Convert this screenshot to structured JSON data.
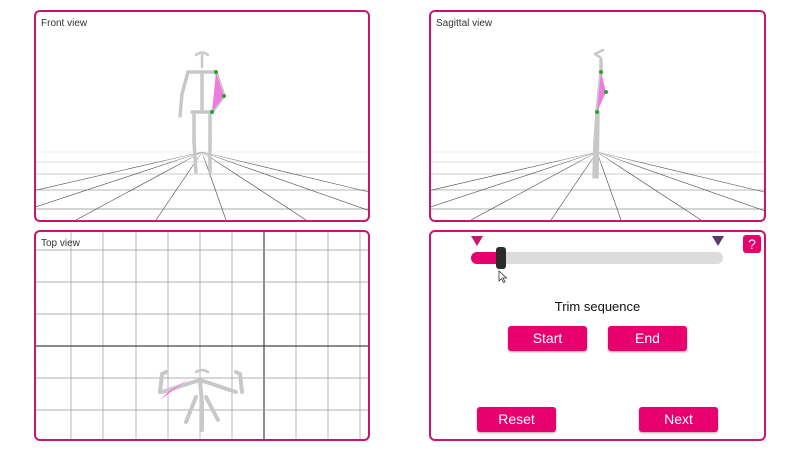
{
  "views": {
    "front_title": "Front view",
    "sagittal_title": "Sagittal view",
    "top_title": "Top view"
  },
  "controls": {
    "help_label": "?",
    "trim_label": "Trim sequence",
    "start_label": "Start",
    "end_label": "End",
    "reset_label": "Reset",
    "next_label": "Next",
    "slider_value_fraction": 0.12
  },
  "colors": {
    "accent": "#e8006f",
    "panel_border": "#c8166e",
    "highlight": "#f07ae0",
    "joint": "#22aa22",
    "bone": "#c8c8c8"
  },
  "icons": {
    "start_marker": "triangle-down-icon",
    "end_marker": "triangle-down-icon",
    "cursor": "mouse-pointer-icon"
  }
}
